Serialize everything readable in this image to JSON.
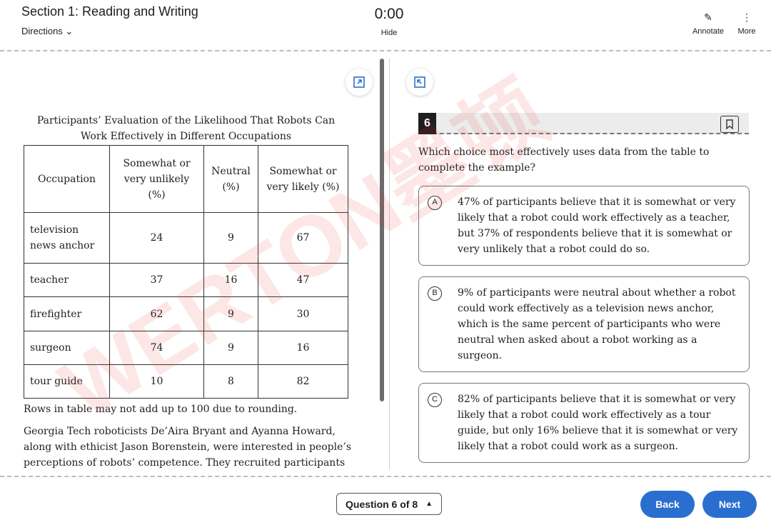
{
  "header": {
    "section_title": "Section 1: Reading and Writing",
    "directions_label": "Directions",
    "timer": "0:00",
    "hide_label": "Hide",
    "annotate_label": "Annotate",
    "more_label": "More"
  },
  "passage": {
    "table_caption": "Participants’ Evaluation of the Likelihood That Robots Can Work Effectively in Different Occupations",
    "columns": [
      "Occupation",
      "Somewhat or very unlikely (%)",
      "Neutral (%)",
      "Somewhat or very likely (%)"
    ],
    "rows": [
      [
        "television news anchor",
        "24",
        "9",
        "67"
      ],
      [
        "teacher",
        "37",
        "16",
        "47"
      ],
      [
        "firefighter",
        "62",
        "9",
        "30"
      ],
      [
        "surgeon",
        "74",
        "9",
        "16"
      ],
      [
        "tour guide",
        "10",
        "8",
        "82"
      ]
    ],
    "note": "Rows in table may not add up to 100 due to rounding.",
    "text": "Georgia Tech roboticists De’Aira Bryant and Ayanna Howard, along with ethicist Jason Borenstein, were interested in people’s perceptions of robots’ competence. They recruited participants"
  },
  "question": {
    "number": "6",
    "prompt": "Which choice most effectively uses data from the table to complete the example?",
    "choices": [
      {
        "letter": "A",
        "text": "47% of participants believe that it is somewhat or very likely that a robot could work effectively as a teacher, but 37% of respondents believe that it is somewhat or very unlikely that a robot could do so."
      },
      {
        "letter": "B",
        "text": "9% of participants were neutral about whether a robot could work effectively as a television news anchor, which is the same percent of participants who were neutral when asked about a robot working as a surgeon."
      },
      {
        "letter": "C",
        "text": "82% of participants believe that it is somewhat or very likely that a robot could work effectively as a tour guide, but only 16% believe that it is somewhat or very likely that a robot could work as a surgeon."
      }
    ]
  },
  "footer": {
    "question_nav": "Question 6 of 8",
    "back_label": "Back",
    "next_label": "Next"
  },
  "watermark": "WERTON墨顿",
  "colors": {
    "accent": "#2a6fcf",
    "watermark": "#e53935"
  }
}
